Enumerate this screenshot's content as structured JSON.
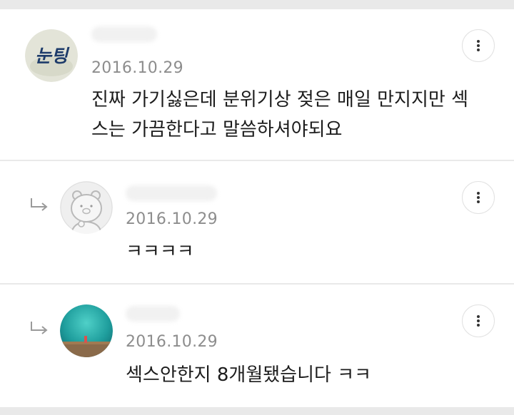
{
  "comments": [
    {
      "date": "2016.10.29",
      "text": "진짜 가기싫은데 분위기상 젖은 매일 만지지만 섹스는 가끔한다고 말씀하셔야되요",
      "avatar_label": "눈팅"
    },
    {
      "date": "2016.10.29",
      "text": "ㅋㅋㅋㅋ"
    },
    {
      "date": "2016.10.29",
      "text": "섹스안한지 8개월됐습니다 ㅋㅋ"
    }
  ]
}
